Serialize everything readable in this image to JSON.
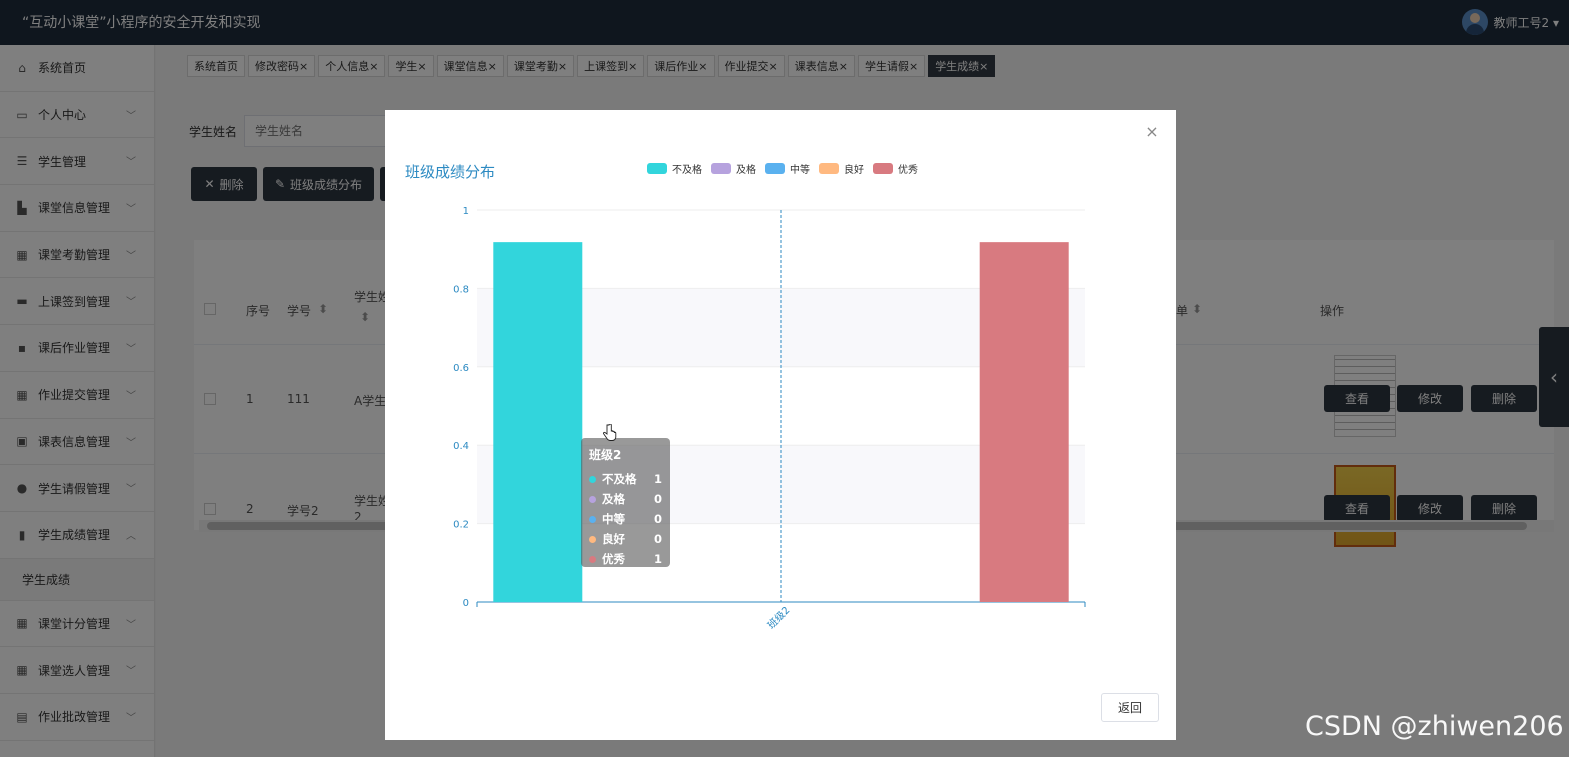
{
  "header": {
    "title": "“互动小课堂”小程序的安全开发和实现",
    "user_label": "教师工号2 ▾"
  },
  "sidebar": {
    "items": [
      {
        "label": "系统首页",
        "icon": "home-icon",
        "expandable": false
      },
      {
        "label": "个人中心",
        "icon": "profile-icon",
        "expandable": true
      },
      {
        "label": "学生管理",
        "icon": "sliders-icon",
        "expandable": true
      },
      {
        "label": "课堂信息管理",
        "icon": "briefcase-icon",
        "expandable": true
      },
      {
        "label": "课堂考勤管理",
        "icon": "grid-icon",
        "expandable": true
      },
      {
        "label": "上课签到管理",
        "icon": "monitor-icon",
        "expandable": true
      },
      {
        "label": "课后作业管理",
        "icon": "message-icon",
        "expandable": true
      },
      {
        "label": "作业提交管理",
        "icon": "grid-icon",
        "expandable": true
      },
      {
        "label": "课表信息管理",
        "icon": "case-icon",
        "expandable": true
      },
      {
        "label": "学生请假管理",
        "icon": "user-icon",
        "expandable": true
      },
      {
        "label": "学生成绩管理",
        "icon": "bar-chart-icon",
        "expandable": true,
        "expanded": true
      }
    ],
    "sub_item": "学生成绩",
    "items_after": [
      {
        "label": "课堂计分管理",
        "icon": "grid-icon",
        "expandable": true
      },
      {
        "label": "课堂选人管理",
        "icon": "grid-icon",
        "expandable": true
      },
      {
        "label": "作业批改管理",
        "icon": "clipboard-icon",
        "expandable": true
      }
    ]
  },
  "tabs": [
    {
      "label": "系统首页"
    },
    {
      "label": "修改密码×"
    },
    {
      "label": "个人信息×"
    },
    {
      "label": "学生×"
    },
    {
      "label": "课堂信息×"
    },
    {
      "label": "课堂考勤×"
    },
    {
      "label": "上课签到×"
    },
    {
      "label": "课后作业×"
    },
    {
      "label": "作业提交×"
    },
    {
      "label": "课表信息×"
    },
    {
      "label": "学生请假×"
    },
    {
      "label": "学生成绩×",
      "active": true
    }
  ],
  "search": {
    "label": "学生姓名",
    "placeholder": "学生姓名"
  },
  "toolbar": {
    "delete_label": "删除",
    "distribution_label": "班级成绩分布"
  },
  "table": {
    "headers": {
      "index": "序号",
      "student_id": "学号",
      "student_name": "学生姓",
      "report": "单",
      "actions": "操作"
    },
    "rows": [
      {
        "index": "1",
        "student_id": "111",
        "student_name": "A学生"
      },
      {
        "index": "2",
        "student_id": "学号2",
        "student_name": "学生姓",
        "student_name_line2": "2"
      }
    ],
    "action_labels": {
      "view": "查看",
      "edit": "修改",
      "delete": "删除"
    }
  },
  "modal": {
    "title": "班级成绩分布",
    "return_label": "返回",
    "close_label": "×"
  },
  "chart_data": {
    "type": "bar",
    "title": "班级成绩分布",
    "categories": [
      "班级2"
    ],
    "series": [
      {
        "name": "不及格",
        "values": [
          1
        ],
        "color": "#32d5dc"
      },
      {
        "name": "及格",
        "values": [
          0
        ],
        "color": "#b6a2de"
      },
      {
        "name": "中等",
        "values": [
          0
        ],
        "color": "#5ab1ef"
      },
      {
        "name": "良好",
        "values": [
          0
        ],
        "color": "#ffb980"
      },
      {
        "name": "优秀",
        "values": [
          1
        ],
        "color": "#d87a80"
      }
    ],
    "yticks": [
      "0",
      "0.2",
      "0.4",
      "0.6",
      "0.8",
      "1"
    ],
    "ylim": [
      0,
      1
    ],
    "grid": true,
    "legend": "top-center",
    "tooltip": {
      "title": "班级2",
      "rows": [
        {
          "name": "不及格",
          "value": "1"
        },
        {
          "name": "及格",
          "value": "0"
        },
        {
          "name": "中等",
          "value": "0"
        },
        {
          "name": "良好",
          "value": "0"
        },
        {
          "name": "优秀",
          "value": "1"
        }
      ]
    }
  },
  "watermark": "CSDN @zhiwen206"
}
